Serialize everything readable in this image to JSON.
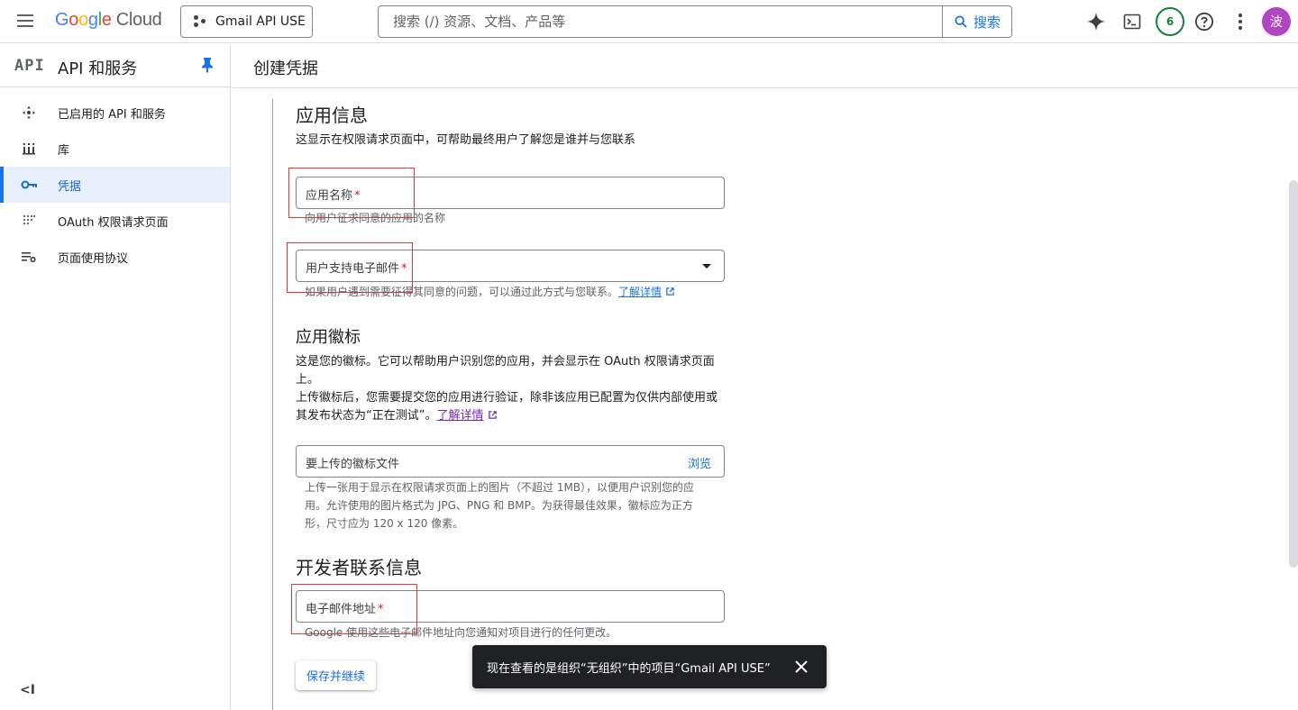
{
  "topbar": {
    "logo_google": [
      "G",
      "o",
      "o",
      "g",
      "l",
      "e"
    ],
    "logo_cloud": "Cloud",
    "project": "Gmail API USE",
    "search_placeholder": "搜索 (/) 资源、文档、产品等",
    "search_button": "搜索",
    "notifications_count": "6",
    "avatar_letter": "波"
  },
  "sidebar": {
    "logo": "API",
    "title": "API 和服务",
    "items": [
      {
        "label": "已启用的 API 和服务",
        "icon": "apis-icon"
      },
      {
        "label": "库",
        "icon": "library-icon"
      },
      {
        "label": "凭据",
        "icon": "key-icon",
        "active": true
      },
      {
        "label": "OAuth 权限请求页面",
        "icon": "oauth-icon"
      },
      {
        "label": "页面使用协议",
        "icon": "page-usage-icon"
      }
    ],
    "collapse": "<I"
  },
  "page": {
    "title": "创建凭据"
  },
  "app_info": {
    "heading": "应用信息",
    "description": "这显示在权限请求页面中，可帮助最终用户了解您是谁并与您联系",
    "app_name_label": "应用名称",
    "app_name_hint": "向用户征求同意的应用的名称",
    "support_email_label": "用户支持电子邮件",
    "support_email_hint": "如果用户遇到需要征得其同意的问题，可以通过此方式与您联系。",
    "learn_more": "了解详情",
    "required_mark": "*"
  },
  "app_logo": {
    "heading": "应用徽标",
    "line1": "这是您的徽标。它可以帮助用户识别您的应用，并会显示在 OAuth 权限请求页面",
    "line2": "上。",
    "line3": "上传徽标后，您需要提交您的应用进行验证，除非该应用已配置为仅供内部使用或",
    "line4": "其发布状态为“正在测试”。",
    "learn_more": "了解详情",
    "upload_label": "要上传的徽标文件",
    "browse": "浏览",
    "hint1": "上传一张用于显示在权限请求页面上的图片（不超过 1MB），以便用户识别您的应",
    "hint2": "用。允许使用的图片格式为 JPG、PNG 和 BMP。为获得最佳效果，徽标应为正方",
    "hint3": "形，尺寸应为 120 x 120 像素。"
  },
  "developer": {
    "heading": "开发者联系信息",
    "email_label": "电子邮件地址",
    "email_hint": "Google 使用这些电子邮件地址向您通知对项目进行的任何更改。"
  },
  "save_button": "保存并继续",
  "snackbar": {
    "message": "现在查看的是组织“无组织”中的项目“Gmail API USE”"
  },
  "colors": {
    "accent": "#1a73e8",
    "highlight_box": "#e53935",
    "avatar_bg": "#b146c2",
    "badge": "#188038"
  }
}
